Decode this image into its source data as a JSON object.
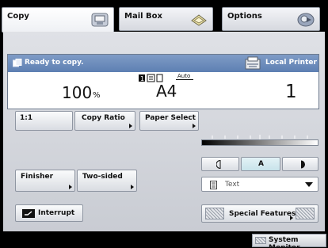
{
  "tabs": [
    {
      "label": "Copy",
      "icon": "copier-icon",
      "selected": true
    },
    {
      "label": "Mail Box",
      "icon": "mailbox-icon",
      "selected": false
    },
    {
      "label": "Options",
      "icon": "options-icon",
      "selected": false
    }
  ],
  "status": {
    "message": "Ready to copy.",
    "printer": "Local Printer",
    "zoom": "100",
    "zoom_unit": "%",
    "paper_size": "A4",
    "paper_mode": "Auto",
    "copies": "1"
  },
  "buttons": {
    "one_to_one": "1:1",
    "copy_ratio": "Copy Ratio",
    "paper_select": "Paper Select",
    "finisher": "Finisher",
    "two_sided": "Two-sided",
    "interrupt": "Interrupt",
    "special_features": "Special Features"
  },
  "density": {
    "auto_label": "A",
    "level_fraction": 0.5,
    "mode": "Text"
  },
  "statusbar": {
    "system_monitor": "System Monitor"
  },
  "colors": {
    "status_header": "#6d8cbc",
    "tab_ring": "#000000"
  }
}
